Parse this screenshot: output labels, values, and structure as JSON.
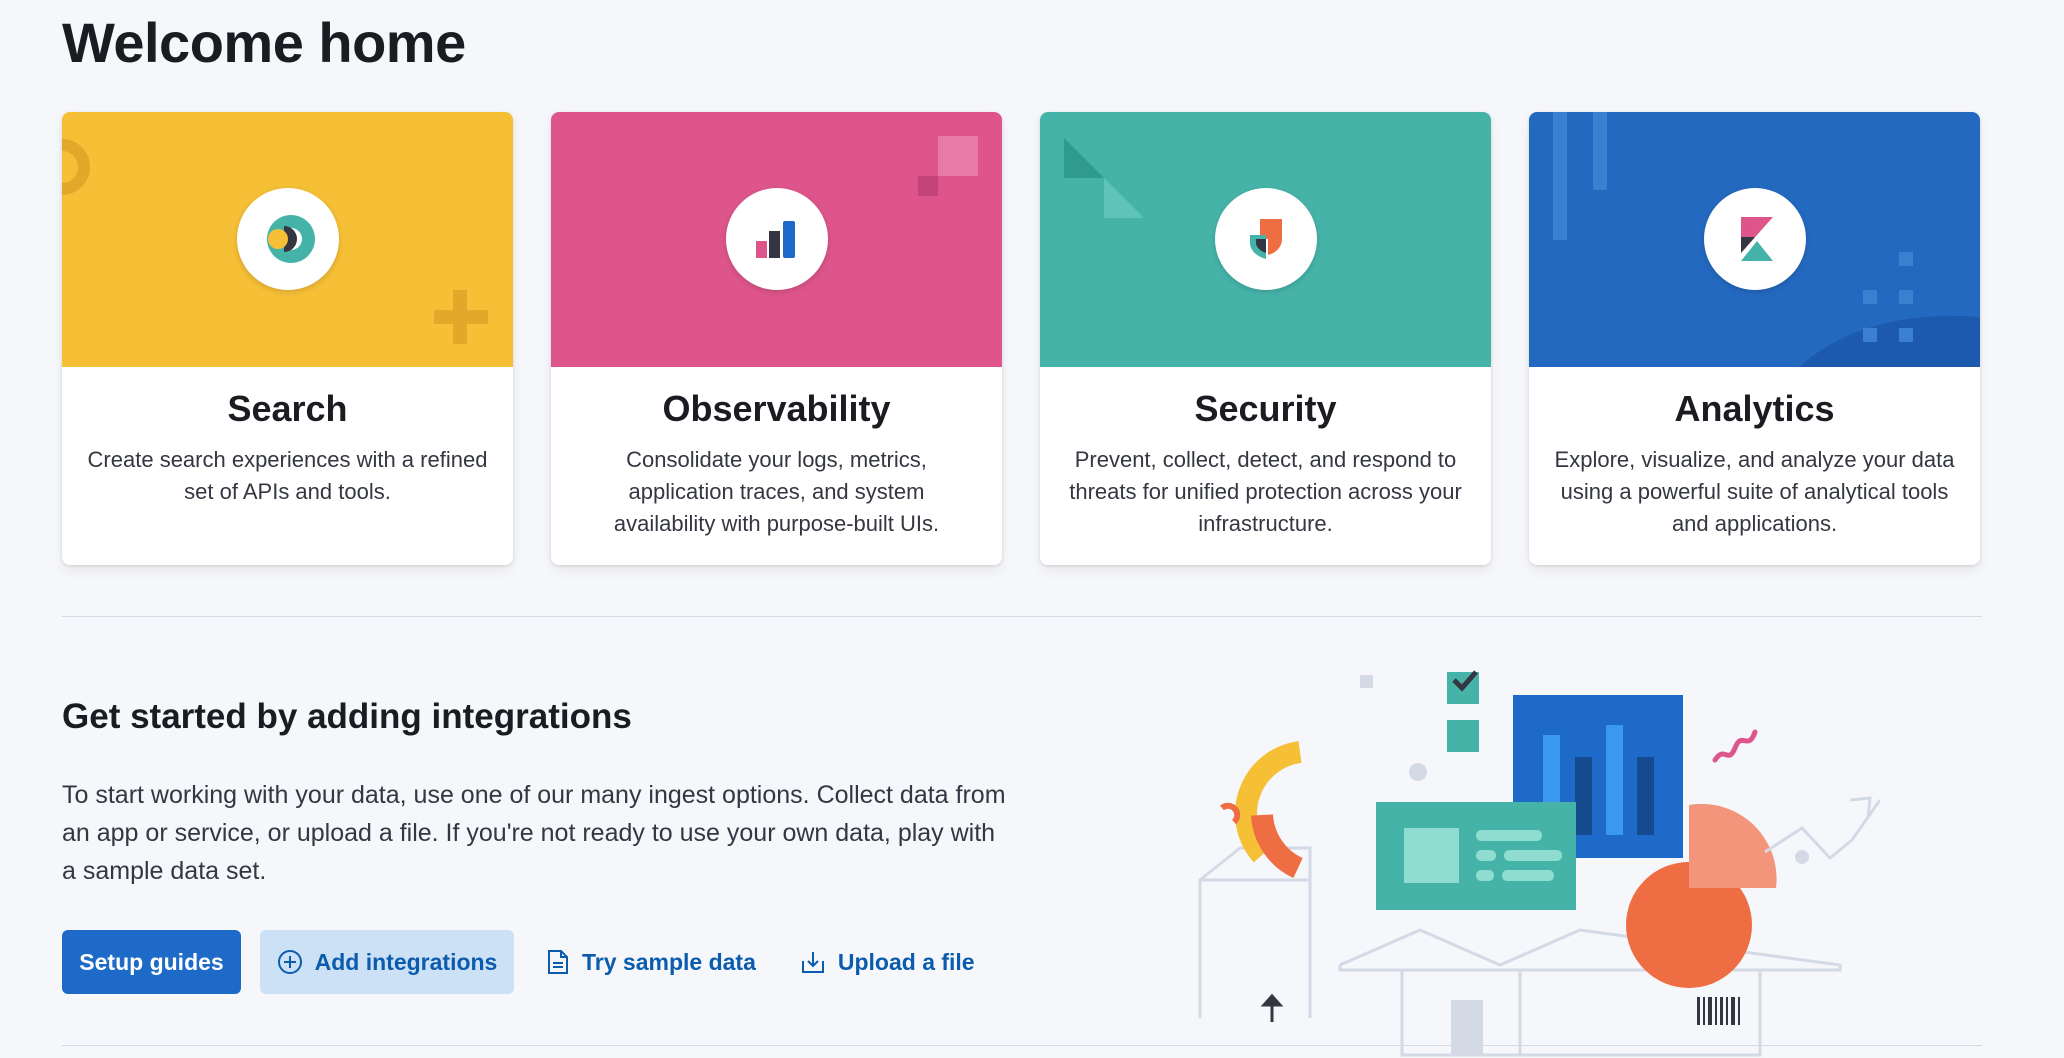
{
  "page": {
    "title": "Welcome home"
  },
  "solutions": [
    {
      "name": "Search",
      "description": "Create search experiences with a refined set of APIs and tools.",
      "banner_color": "#f5bf36",
      "icon": "elastic-search-logo-icon"
    },
    {
      "name": "Observability",
      "description": "Consolidate your logs, metrics, application traces, and system availability with purpose-built UIs.",
      "banner_color": "#dd558a",
      "icon": "observability-logo-icon"
    },
    {
      "name": "Security",
      "description": "Prevent, collect, detect, and respond to threats for unified protection across your infrastructure.",
      "banner_color": "#46b3a9",
      "icon": "security-logo-icon"
    },
    {
      "name": "Analytics",
      "description": "Explore, visualize, and analyze your data using a powerful suite of analytical tools and applications.",
      "banner_color": "#2469c0",
      "icon": "kibana-logo-icon"
    }
  ],
  "integrations": {
    "title": "Get started by adding integrations",
    "description": "To start working with your data, use one of our many ingest options. Collect data from an app or service, or upload a file. If you're not ready to use your own data, play with a sample data set.",
    "buttons": {
      "setup_guides": "Setup guides",
      "add_integrations": "Add integrations",
      "try_sample_data": "Try sample data",
      "upload_file": "Upload a file"
    },
    "icons": {
      "add": "plus-circle-icon",
      "sample_data": "document-icon",
      "upload": "import-icon"
    }
  },
  "colors": {
    "primary": "#1d6ac8",
    "link": "#0b5cad",
    "secondary_bg": "#cce1f6"
  }
}
